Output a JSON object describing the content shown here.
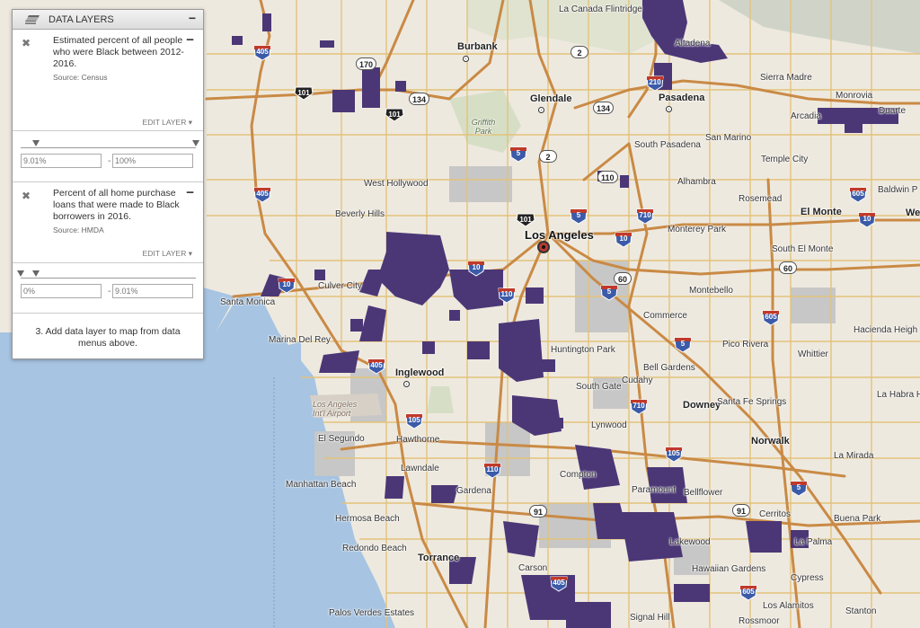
{
  "panel": {
    "title": "DATA LAYERS",
    "collapse_symbol": "−",
    "layers": [
      {
        "description": "Estimated percent of all people who were Black between 2012-2016.",
        "source": "Source: Census",
        "edit_label": "EDIT LAYER ▾",
        "range_min": "9.01%",
        "range_max": "100%",
        "remove_symbol": "✖",
        "minus_symbol": "−"
      },
      {
        "description": "Percent of all home purchase loans that were made to Black borrowers in 2016.",
        "source": "Source: HMDA",
        "edit_label": "EDIT LAYER ▾",
        "range_min": "0%",
        "range_max": "9.01%",
        "remove_symbol": "✖",
        "minus_symbol": "−"
      }
    ],
    "add_message": "3. Add data layer to map from data menus above."
  },
  "map": {
    "colors": {
      "land": "#eee9df",
      "water": "#a7c4e2",
      "freeway": "#c98a45",
      "arterial": "#e3c27a",
      "overlay": "#4b3776",
      "gray": "#c7c7c7",
      "park": "#d6dfc6"
    },
    "places": {
      "la_canada": "La Canada Flintridge",
      "burbank": "Burbank",
      "altadena": "Altadena",
      "sierra_madre": "Sierra Madre",
      "monrovia": "Monrovia",
      "glendale": "Glendale",
      "pasadena": "Pasadena",
      "arcadia": "Arcadia",
      "duarte": "Duarte",
      "griffith": "Griffith Park",
      "south_pasadena": "South Pasadena",
      "san_marino": "San Marino",
      "temple_city": "Temple City",
      "west_hollywood": "West Hollywood",
      "alhambra": "Alhambra",
      "rosemead": "Rosemead",
      "baldwin_park": "Baldwin P",
      "beverly_hills": "Beverly Hills",
      "el_monte": "El Monte",
      "west": "We",
      "los_angeles": "Los Angeles",
      "monterey_park": "Monterey Park",
      "south_el_monte": "South El Monte",
      "culver_city": "Culver City",
      "santa_monica": "Santa Monica",
      "montebello": "Montebello",
      "commerce": "Commerce",
      "marina_del_rey": "Marina Del Rey",
      "huntington_park": "Huntington Park",
      "pico_rivera": "Pico Rivera",
      "hacienda_heights": "Hacienda Heigh",
      "inglewood": "Inglewood",
      "bell_gardens": "Bell Gardens",
      "whittier": "Whittier",
      "south_gate": "South Gate",
      "cudahy": "Cudahy",
      "downey": "Downey",
      "santa_fe_springs": "Santa Fe Springs",
      "la_habra_heights": "La Habra Heigh",
      "lax": "Los Angeles Int'l Airport",
      "lynwood": "Lynwood",
      "el_segundo": "El Segundo",
      "hawthorne": "Hawthorne",
      "norwalk": "Norwalk",
      "la_mirada": "La Mirada",
      "lawndale": "Lawndale",
      "compton": "Compton",
      "manhattan_beach": "Manhattan Beach",
      "gardena": "Gardena",
      "paramount": "Paramount",
      "bellflower": "Bellflower",
      "hermosa_beach": "Hermosa Beach",
      "cerritos": "Cerritos",
      "buena_park": "Buena Park",
      "lakewood": "Lakewood",
      "la_palma": "La Palma",
      "redondo_beach": "Redondo Beach",
      "torrance": "Torrance",
      "carson": "Carson",
      "hawaiian_gardens": "Hawaiian Gardens",
      "cypress": "Cypress",
      "los_alamitos": "Los Alamitos",
      "palos_verdes": "Palos Verdes Estates",
      "signal_hill": "Signal Hill",
      "rossmoor": "Rossmoor",
      "stanton": "Stanton"
    },
    "shields": {
      "i405a": "405",
      "i210": "210",
      "i5a": "5",
      "i5b": "5",
      "i5c": "5",
      "i5d": "5",
      "i5e": "5",
      "i605a": "605",
      "i605b": "605",
      "i605c": "605",
      "i710a": "710",
      "i710b": "710",
      "i10a": "10",
      "i10b": "10",
      "i10c": "10",
      "i405b": "405",
      "i405c": "405",
      "i405d": "405",
      "i110a": "110",
      "i110b": "110",
      "i105a": "105",
      "i105b": "105"
    },
    "routes": {
      "r170": "170",
      "r134a": "134",
      "r134b": "134",
      "r2a": "2",
      "r2b": "2",
      "r110": "110",
      "r60a": "60",
      "r60b": "60",
      "r91a": "91",
      "r91b": "91",
      "us101a": "101",
      "us101b": "101",
      "us101c": "101"
    }
  }
}
